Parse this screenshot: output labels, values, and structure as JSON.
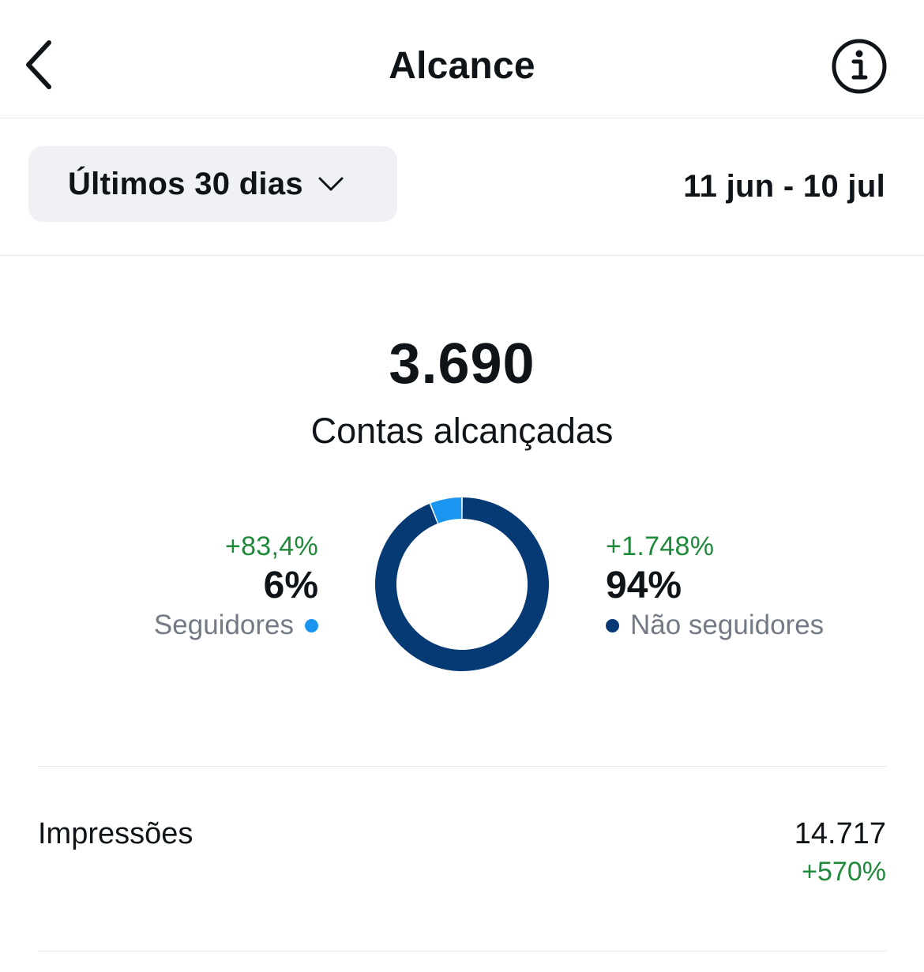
{
  "header": {
    "title": "Alcance",
    "back_icon": "chevron-left-icon",
    "info_icon": "info-icon"
  },
  "filter": {
    "period_label": "Últimos 30 dias",
    "dropdown_icon": "chevron-down-icon",
    "date_range": "11 jun - 10 jul"
  },
  "summary": {
    "value": "3.690",
    "label": "Contas alcançadas"
  },
  "chart_data": {
    "type": "pie",
    "variant": "donut",
    "categories": [
      "Seguidores",
      "Não seguidores"
    ],
    "values": [
      6,
      94
    ],
    "unit": "%",
    "series": [
      {
        "name": "Seguidores",
        "value": 6,
        "delta": "+83,4%",
        "color": "#1a95f0"
      },
      {
        "name": "Não seguidores",
        "value": 94,
        "delta": "+1.748%",
        "color": "#063a74"
      }
    ]
  },
  "breakdown": {
    "followers": {
      "delta": "+83,4%",
      "percent": "6%",
      "label": "Seguidores"
    },
    "non_followers": {
      "delta": "+1.748%",
      "percent": "94%",
      "label": "Não seguidores"
    }
  },
  "impressions": {
    "label": "Impressões",
    "value": "14.717",
    "delta": "+570%"
  },
  "colors": {
    "followers": "#1a95f0",
    "non_followers": "#063a74",
    "positive": "#1f8a3b",
    "muted": "#737a86"
  }
}
